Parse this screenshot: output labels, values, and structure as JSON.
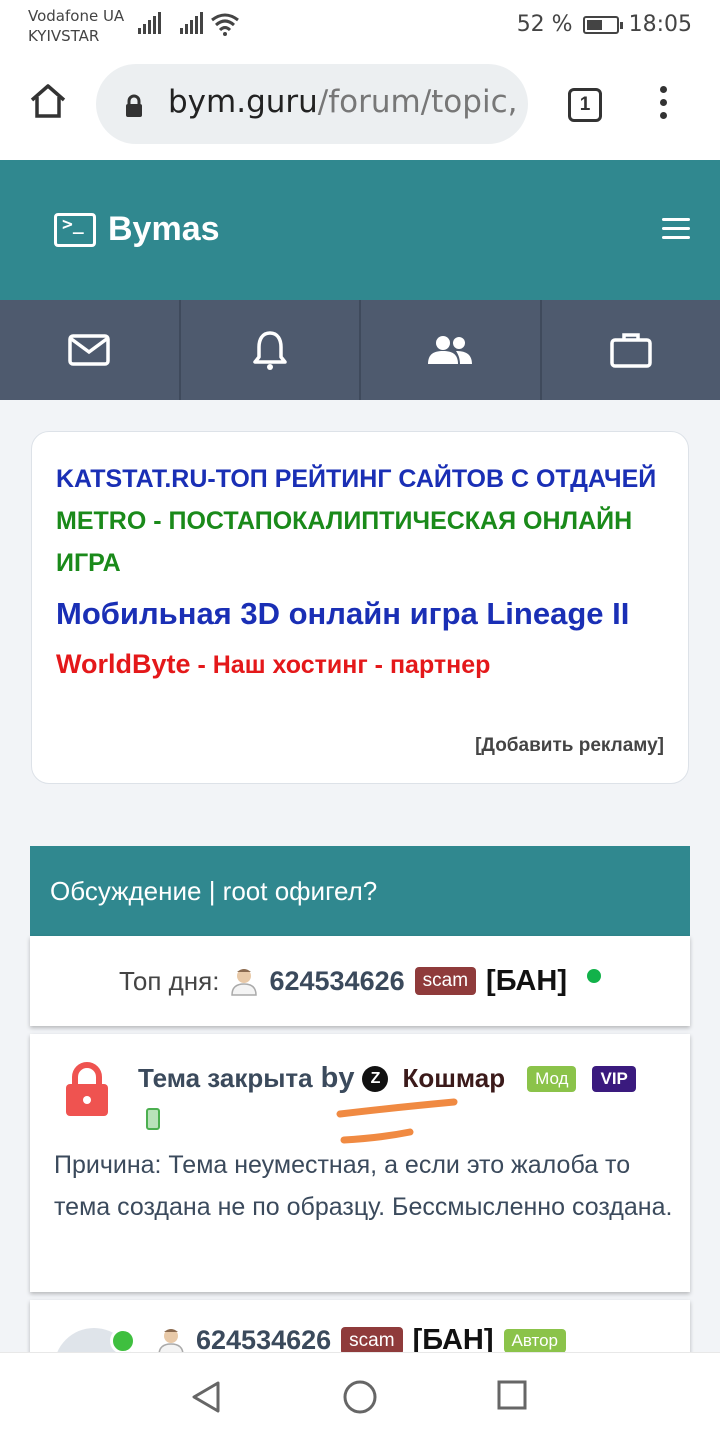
{
  "status_bar": {
    "carrier_1": "Vodafone UA",
    "carrier_2": "KYIVSTAR",
    "battery": "52 %",
    "time": "18:05"
  },
  "browser": {
    "url_domain": "bym.guru",
    "url_path": "/forum/topic,",
    "tab_count": "1"
  },
  "site": {
    "logo_text": "Bymas",
    "brand_color": "#30888f",
    "nav_icons": [
      "mail-icon",
      "bell-icon",
      "users-icon",
      "briefcase-icon"
    ]
  },
  "ads": {
    "ad1": "KATSTAT.RU-ТОП РЕЙТИНГ САЙТОВ С ОТДАЧЕЙ",
    "ad2": "METRO - ПОСТАПОКАЛИПТИЧЕСКАЯ ОНЛАЙН ИГРА",
    "ad3": "Мобильная 3D онлайн игра Lineage II",
    "ad4_brand": "WorldByte",
    "ad4_rest": " - Наш хостинг - партнер",
    "add_link": "[Добавить рекламу]"
  },
  "topic": {
    "title": "Обсуждение | root офигел?"
  },
  "top_day": {
    "label": "Топ дня:",
    "user": "624534626",
    "tag": "scam",
    "ban": "[БАН]"
  },
  "closed": {
    "label": "Тема закрыта",
    "by": "by",
    "moderator_icon_letter": "Z",
    "moderator": "Кошмар",
    "tag_mod": "Мод",
    "tag_vip": "VIP",
    "reason": "Причина: Тема неуместная, а если это жалоба то тема создана не по образцу. Бессмысленно создана."
  },
  "post": {
    "user": "624534626",
    "tag": "scam",
    "ban": "[БАН]",
    "tag_author": "Автор"
  }
}
